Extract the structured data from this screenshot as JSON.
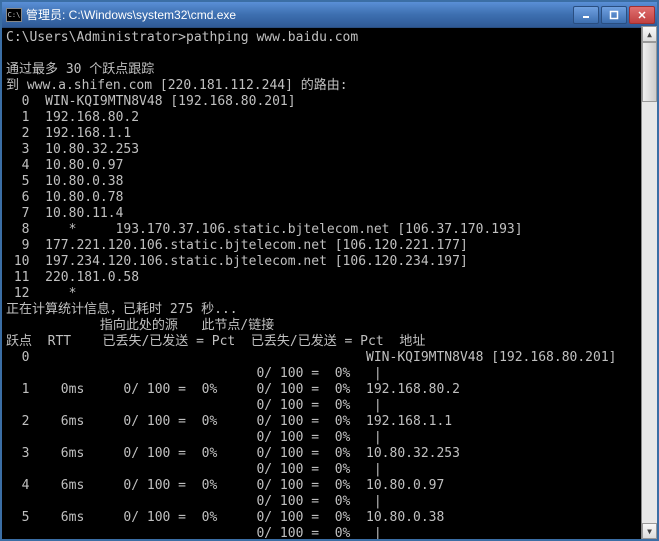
{
  "window": {
    "icon_label": "C:\\",
    "title": "管理员: C:\\Windows\\system32\\cmd.exe"
  },
  "prompt": "C:\\Users\\Administrator>",
  "command": "pathping www.baidu.com",
  "trace": {
    "intro1": "通过最多 30 个跃点跟踪",
    "intro2_a": "到 www.a.shifen.com [",
    "intro2_ip": "220.181.112.244",
    "intro2_b": "] 的路由:",
    "hops": [
      {
        "n": "0",
        "text": "WIN-KQI9MTN8V48 [192.168.80.201]"
      },
      {
        "n": "1",
        "text": "192.168.80.2"
      },
      {
        "n": "2",
        "text": "192.168.1.1"
      },
      {
        "n": "3",
        "text": "10.80.32.253"
      },
      {
        "n": "4",
        "text": "10.80.0.97"
      },
      {
        "n": "5",
        "text": "10.80.0.38"
      },
      {
        "n": "6",
        "text": "10.80.0.78"
      },
      {
        "n": "7",
        "text": "10.80.11.4"
      },
      {
        "n": "8",
        "text": "   *     193.170.37.106.static.bjtelecom.net [106.37.170.193]"
      },
      {
        "n": "9",
        "text": "177.221.120.106.static.bjtelecom.net [106.120.221.177]"
      },
      {
        "n": "10",
        "text": "197.234.120.106.static.bjtelecom.net [106.120.234.197]"
      },
      {
        "n": "11",
        "text": "220.181.0.58"
      },
      {
        "n": "12",
        "text": "   *"
      }
    ]
  },
  "stats": {
    "computing": "正在计算统计信息，已耗时 275 秒...",
    "hdr1": "            指向此处的源   此节点/链接",
    "hdr2": "跃点  RTT    已丢失/已发送 = Pct  已丢失/已发送 = Pct  地址",
    "rows": [
      {
        "l1": "  0                                           WIN-KQI9MTN8V48 [192.168.80.201]",
        "l2": "                                0/ 100 =  0%   |"
      },
      {
        "l1": "  1    0ms     0/ 100 =  0%     0/ 100 =  0%  192.168.80.2",
        "l2": "                                0/ 100 =  0%   |"
      },
      {
        "l1": "  2    6ms     0/ 100 =  0%     0/ 100 =  0%  192.168.1.1",
        "l2": "                                0/ 100 =  0%   |"
      },
      {
        "l1": "  3    6ms     0/ 100 =  0%     0/ 100 =  0%  10.80.32.253",
        "l2": "                                0/ 100 =  0%   |"
      },
      {
        "l1": "  4    6ms     0/ 100 =  0%     0/ 100 =  0%  10.80.0.97",
        "l2": "                                0/ 100 =  0%   |"
      },
      {
        "l1": "  5    6ms     0/ 100 =  0%     0/ 100 =  0%  10.80.0.38",
        "l2": "                                0/ 100 =  0%   |"
      }
    ]
  }
}
